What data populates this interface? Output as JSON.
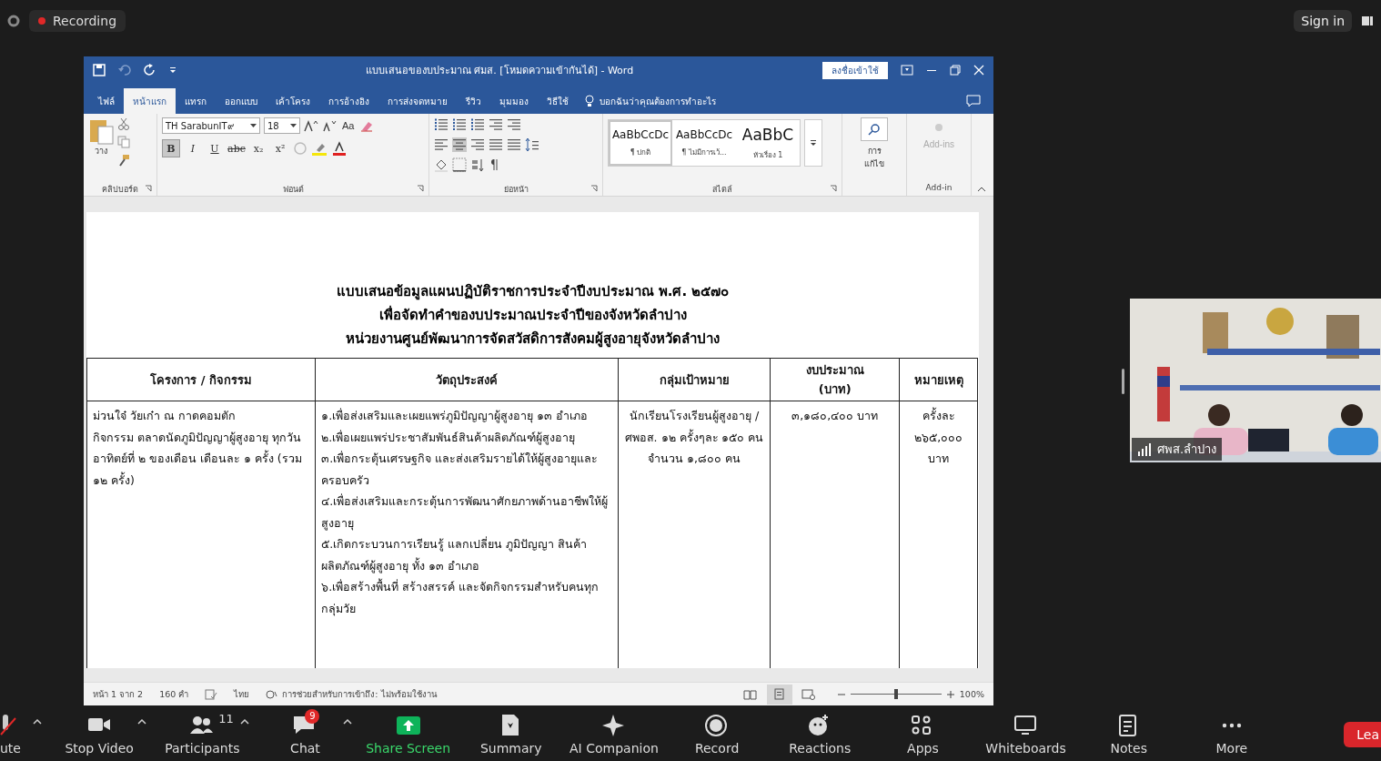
{
  "meeting_bar": {
    "recording": "Recording",
    "sign_in": "Sign in"
  },
  "word": {
    "title": "แบบเสนอของบประมาณ ศมส. [โหมดความเข้ากันได้] - Word",
    "sign_in_button": "ลงชื่อเข้าใช้",
    "tabs": [
      {
        "label": "ไฟล์",
        "selected": false
      },
      {
        "label": "หน้าแรก",
        "selected": true
      },
      {
        "label": "แทรก",
        "selected": false
      },
      {
        "label": "ออกแบบ",
        "selected": false
      },
      {
        "label": "เค้าโครง",
        "selected": false
      },
      {
        "label": "การอ้างอิง",
        "selected": false
      },
      {
        "label": "การส่งจดหมาย",
        "selected": false
      },
      {
        "label": "รีวิว",
        "selected": false
      },
      {
        "label": "มุมมอง",
        "selected": false
      },
      {
        "label": "วิธีใช้",
        "selected": false
      }
    ],
    "tell_me": "บอกฉันว่าคุณต้องการทำอะไร",
    "ribbon": {
      "paste": "วาง",
      "font_name": "TH SarabunIT๙",
      "font_size": "18",
      "case_button": "Aa",
      "format_buttons": [
        {
          "label": "B",
          "selected": true
        },
        {
          "label": "I",
          "selected": false
        },
        {
          "label": "U",
          "selected": false
        },
        {
          "label": "abc",
          "selected": false
        },
        {
          "label": "x₂",
          "selected": false
        },
        {
          "label": "x²",
          "selected": false
        }
      ],
      "styles": [
        {
          "sample": "AaBbCcDc",
          "name": "¶ ปกติ",
          "selected": true
        },
        {
          "sample": "AaBbCcDc",
          "name": "¶ ไม่มีการเว้...",
          "selected": false
        },
        {
          "sample": "AaBbC",
          "name": "หัวเรื่อง 1",
          "selected": false
        }
      ],
      "find_lines": [
        "การ",
        "แก้ไข"
      ],
      "addins": "Add-ins",
      "groups": [
        "คลิปบอร์ด",
        "ฟอนต์",
        "ย่อหน้า",
        "สไตล์",
        "Add-in"
      ]
    },
    "document": {
      "headings": [
        "แบบเสนอข้อมูลแผนปฏิบัติราชการประจำปีงบประมาณ พ.ศ. ๒๕๗๐",
        "เพื่อจัดทำคำของบประมาณประจำปีของจังหวัดลำปาง",
        "หน่วยงานศูนย์พัฒนาการจัดสวัสดิการสังคมผู้สูงอายุจังหวัดลำปาง"
      ],
      "table": {
        "columns": [
          "โครงการ / กิจกรรม",
          "วัตถุประสงค์",
          "กลุ่มเป้าหมาย",
          "งบประมาณ (บาท)",
          "หมายเหตุ"
        ],
        "rows": [
          {
            "cells": [
              {
                "kind": "left",
                "paragraphs": [
                  "ม่วนใจ๋ วัยเก๋า ณ กาดคอมตัก",
                  "กิจกรรม ตลาดนัดภูมิปัญญาผู้สูงอายุ ทุกวันอาทิตย์ที่ ๒ ของเดือน เดือนละ ๑ ครั้ง (รวม ๑๒ ครั้ง)"
                ]
              },
              {
                "kind": "left",
                "paragraphs": [
                  "๑.เพื่อส่งเสริมและเผยแพร่ภูมิปัญญาผู้สูงอายุ ๑๓ อำเภอ",
                  "๒.เพื่อเผยแพร่ประชาสัมพันธ์สินค้าผลิตภัณฑ์ผู้สูงอายุ",
                  "๓.เพื่อกระตุ้นเศรษฐกิจ และส่งเสริมรายได้ให้ผู้สูงอายุและครอบครัว",
                  "๔.เพื่อส่งเสริมและกระตุ้นการพัฒนาศักยภาพด้านอาชีพให้ผู้สูงอายุ",
                  "๕.เกิดกระบวนการเรียนรู้ แลกเปลี่ยน ภูมิปัญญา สินค้าผลิตภัณฑ์ผู้สูงอายุ ทั้ง ๑๓ อำเภอ",
                  "๖.เพื่อสร้างพื้นที่ สร้างสรรค์ และจัดกิจกรรมสำหรับคนทุกกลุ่มวัย"
                ]
              },
              {
                "kind": "center",
                "paragraphs": [
                  "นักเรียนโรงเรียนผู้สูงอายุ /ศพอส. ๑๒ ครั้งๆละ ๑๕๐ คนจำนวน ๑,๘๐๐ คน"
                ]
              },
              {
                "kind": "center",
                "paragraphs": [
                  "๓,๑๘๐,๔๐๐ บาท"
                ]
              },
              {
                "kind": "center",
                "paragraphs": [
                  "ครั้งละ ๒๖๕,๐๐๐ บาท"
                ]
              }
            ]
          }
        ]
      }
    },
    "status_bar": {
      "page": "หน้า 1 จาก 2",
      "words": "160 คำ",
      "language": "ไทย",
      "accessibility": "การช่วยสำหรับการเข้าถึง: ไม่พร้อมใช้งาน",
      "views": [
        {
          "kind": "read",
          "selected": false
        },
        {
          "kind": "print",
          "selected": true
        },
        {
          "kind": "web",
          "selected": false
        }
      ],
      "zoom": {
        "level": 0.5,
        "reading": "100%"
      }
    }
  },
  "video": {
    "name": "ศพส.ลำปาง"
  },
  "toolbar": {
    "items": [
      {
        "kind": "mic",
        "label": "ute",
        "caret": true
      },
      {
        "kind": "video",
        "label": "Stop Video",
        "caret": true
      },
      {
        "kind": "participants",
        "label": "Participants",
        "count": "11",
        "caret": true
      },
      {
        "kind": "chat",
        "label": "Chat",
        "badge": "9",
        "caret": true
      },
      {
        "kind": "share",
        "label": "Share Screen",
        "caret": false
      },
      {
        "kind": "summary",
        "label": "Summary",
        "caret": false
      },
      {
        "kind": "ai",
        "label": "AI Companion",
        "caret": false
      },
      {
        "kind": "record",
        "label": "Record",
        "caret": false
      },
      {
        "kind": "reactions",
        "label": "Reactions",
        "caret": false
      },
      {
        "kind": "apps",
        "label": "Apps",
        "caret": false
      },
      {
        "kind": "whiteboards",
        "label": "Whiteboards",
        "caret": false
      },
      {
        "kind": "notes",
        "label": "Notes",
        "caret": false
      },
      {
        "kind": "more",
        "label": "More",
        "caret": false
      }
    ],
    "leave": "Lea"
  }
}
